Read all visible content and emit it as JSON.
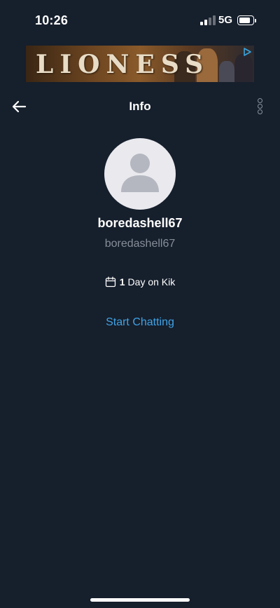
{
  "status_bar": {
    "time": "10:26",
    "network": "5G"
  },
  "ad": {
    "title": "LIONESS"
  },
  "header": {
    "title": "Info"
  },
  "profile": {
    "display_name": "boredashell67",
    "username": "boredashell67",
    "days_count": "1",
    "days_label": "Day on Kik"
  },
  "actions": {
    "start_chatting": "Start Chatting"
  },
  "colors": {
    "background": "#161f2c",
    "link_blue": "#3fa3e6",
    "secondary_text": "#868e99"
  },
  "icons": [
    "back-arrow-icon",
    "more-options-icon",
    "calendar-icon",
    "ad-choices-icon",
    "default-avatar-icon",
    "signal-icon",
    "battery-icon"
  ]
}
